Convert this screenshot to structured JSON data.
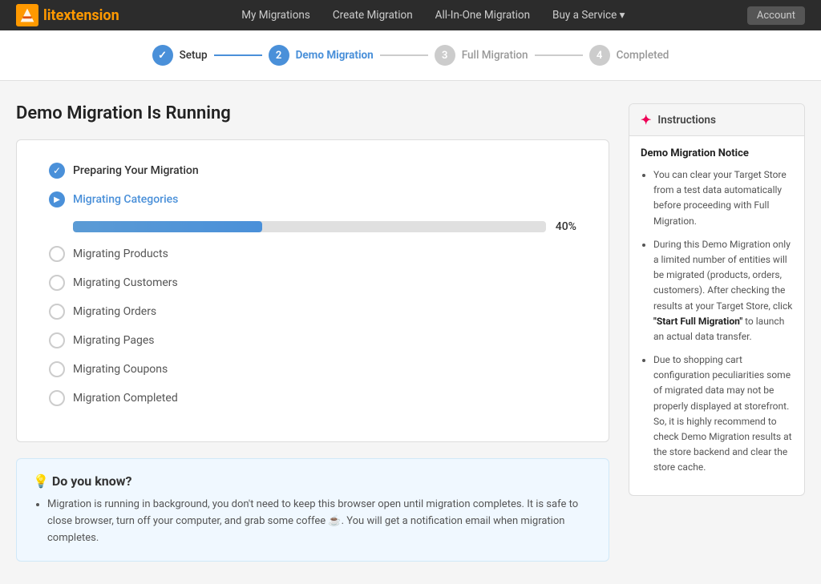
{
  "brand": {
    "name_lit": "lit",
    "name_ext": "extension",
    "logo_alt": "LitExtension"
  },
  "navbar": {
    "links": [
      {
        "label": "My Migrations",
        "key": "my-migrations"
      },
      {
        "label": "Create Migration",
        "key": "create-migration"
      },
      {
        "label": "All-In-One Migration",
        "key": "all-in-one"
      },
      {
        "label": "Buy a Service ▾",
        "key": "buy-service"
      }
    ],
    "user_btn": "Account"
  },
  "stepper": {
    "steps": [
      {
        "number": "✓",
        "label": "Setup",
        "state": "done"
      },
      {
        "number": "2",
        "label": "Demo Migration",
        "state": "active"
      },
      {
        "number": "3",
        "label": "Full Migration",
        "state": "inactive"
      },
      {
        "number": "4",
        "label": "Completed",
        "state": "inactive"
      }
    ]
  },
  "page": {
    "title": "Demo Migration Is Running"
  },
  "migration_steps": [
    {
      "label": "Preparing Your Migration",
      "state": "done"
    },
    {
      "label": "Migrating Categories",
      "state": "active"
    },
    {
      "label": "Migrating Products",
      "state": "empty"
    },
    {
      "label": "Migrating Customers",
      "state": "empty"
    },
    {
      "label": "Migrating Orders",
      "state": "empty"
    },
    {
      "label": "Migrating Pages",
      "state": "empty"
    },
    {
      "label": "Migrating Coupons",
      "state": "empty"
    },
    {
      "label": "Migration Completed",
      "state": "empty"
    }
  ],
  "progress": {
    "percent": 40,
    "label": "40%",
    "fill_width": "40%"
  },
  "did_you_know": {
    "title": "💡 Do you know?",
    "text": "Migration is running in background, you don't need to keep this browser open until migration completes. It is safe to close browser, turn off your computer, and grab some coffee ☕. You will get a notification email when migration completes."
  },
  "instructions": {
    "header": "Instructions",
    "notice_title": "Demo Migration Notice",
    "items": [
      "You can clear your Target Store from a test data automatically before proceeding with Full Migration.",
      "During this Demo Migration only a limited number of entities will be migrated (products, orders, customers). After checking the results at your Target Store, click \"Start Full Migration\" to launch an actual data transfer.",
      "Due to shopping cart configuration peculiarities some of migrated data may not be properly displayed at storefront. So, it is highly recommend to check Demo Migration results at the store backend and clear the store cache."
    ]
  }
}
